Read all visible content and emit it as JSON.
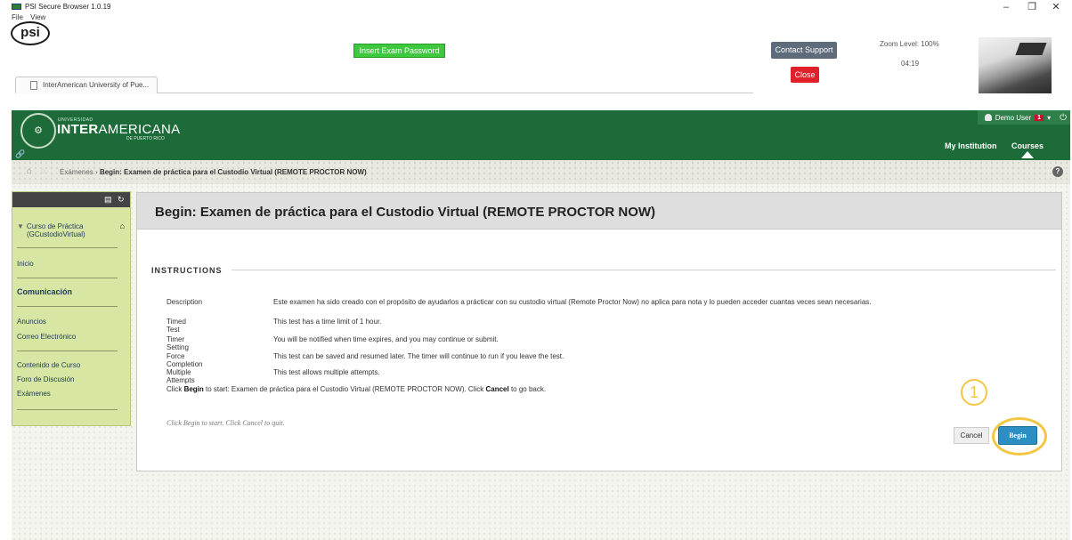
{
  "window": {
    "title": "PSI Secure Browser 1.0.19",
    "menu": [
      "File",
      "View"
    ],
    "controls": {
      "minimize": "–",
      "maximize": "❐",
      "close": "✕"
    }
  },
  "toolbar": {
    "logo_text": "psi",
    "insert_password_label": "Insert Exam Password",
    "contact_support_label": "Contact Support",
    "close_label": "Close",
    "zoom_level": "Zoom Level: 100%",
    "timer": "04:19"
  },
  "browser_tab": {
    "label": "InterAmerican University of Pue..."
  },
  "header": {
    "logo_small": "UNIVERSIDAD",
    "logo_bold": "INTER",
    "logo_light": "AMERICANA",
    "logo_sub": "DE PUERTO RICO",
    "user_name": "Demo User",
    "notification_count": "1",
    "nav": [
      "My Institution",
      "Courses"
    ],
    "colors": {
      "bar": "#1e6b3a",
      "badge": "#c8102e"
    }
  },
  "breadcrumb": {
    "parent": "Exámenes",
    "separator": "›",
    "current": "Begin: Examen de práctica para el Custodio Virtual (REMOTE PROCTOR NOW)"
  },
  "course_menu": {
    "course_title_line1": "Curso de Práctica",
    "course_title_line2": "(GCustodioVirtual)",
    "items": {
      "inicio": "Inicio",
      "comunicacion": "Comunicación",
      "anuncios": "Anuncios",
      "correo": "Correo Electrónico",
      "contenido": "Contenido de Curso",
      "foro": "Foro de Discusión",
      "examenes": "Exámenes"
    }
  },
  "main": {
    "title": "Begin: Examen de práctica para el Custodio Virtual (REMOTE PROCTOR NOW)",
    "section_label": "INSTRUCTIONS",
    "instructions": [
      {
        "label": "Description",
        "value": "Este examen ha sido creado con el propósito de ayudarlos a prácticar con su custodio virtual (Remote Proctor Now) no aplica para nota y lo pueden acceder cuantas veces sean necesarias."
      },
      {
        "label": "Timed Test",
        "value": "This test has a time limit of 1 hour."
      },
      {
        "label": "Timer Setting",
        "value": "You will be notified when time expires, and you may continue or submit."
      },
      {
        "label": "Force Completion",
        "value": "This test can be saved and resumed later. The timer will continue to run if you leave the test."
      },
      {
        "label": "Multiple Attempts",
        "value": "This test allows multiple attempts."
      }
    ],
    "click_prefix": "Click ",
    "click_begin": "Begin",
    "click_middle": " to start: Examen de práctica para el Custodio Virtual (REMOTE PROCTOR NOW). Click ",
    "click_cancel": "Cancel",
    "click_suffix": " to go back.",
    "quit_text": "Click Begin to start. Click Cancel to quit.",
    "cancel_label": "Cancel",
    "begin_label": "Begin"
  },
  "annotation": {
    "step_number": "1",
    "color": "#f3c744"
  }
}
